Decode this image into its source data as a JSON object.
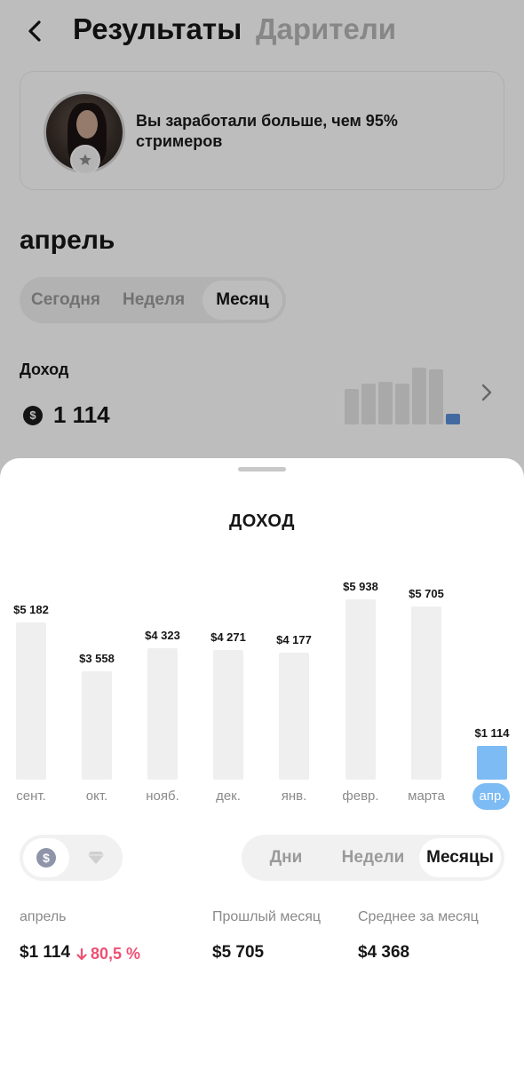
{
  "header": {
    "title_active": "Результаты",
    "title_inactive": "Дарители"
  },
  "profile_card": {
    "text": "Вы заработали больше, чем 95% стримеров"
  },
  "month_title": "апрель",
  "top_period_tabs": [
    "Сегодня",
    "Неделя",
    "Месяц"
  ],
  "top_period_selected": "Месяц",
  "income_summary": {
    "label": "Доход",
    "currency_symbol": "$",
    "value": "1 114"
  },
  "sheet": {
    "title": "ДОХОД",
    "period_tabs": [
      "Дни",
      "Недели",
      "Месяцы"
    ],
    "period_selected": "Месяцы",
    "stats": {
      "current_label": "апрель",
      "current_value": "$1 114",
      "delta": "80,5 %",
      "delta_color": "#ef4f73",
      "prev_label": "Прошлый месяц",
      "prev_value": "$5 705",
      "avg_label": "Среднее за месяц",
      "avg_value": "$4 368"
    }
  },
  "chart_data": {
    "type": "bar",
    "categories": [
      "сент.",
      "окт.",
      "нояб.",
      "дек.",
      "янв.",
      "февр.",
      "марта",
      "апр."
    ],
    "values": [
      5182,
      3558,
      4323,
      4271,
      4177,
      5938,
      5705,
      1114
    ],
    "value_labels": [
      "$5 182",
      "$3 558",
      "$4 323",
      "$4 271",
      "$4 177",
      "$5 938",
      "$5 705",
      "$1 114"
    ],
    "highlighted_category": "апр.",
    "bar_color": "#efefef",
    "highlight_color": "#7dbbf4",
    "ylim": [
      0,
      5938
    ]
  }
}
